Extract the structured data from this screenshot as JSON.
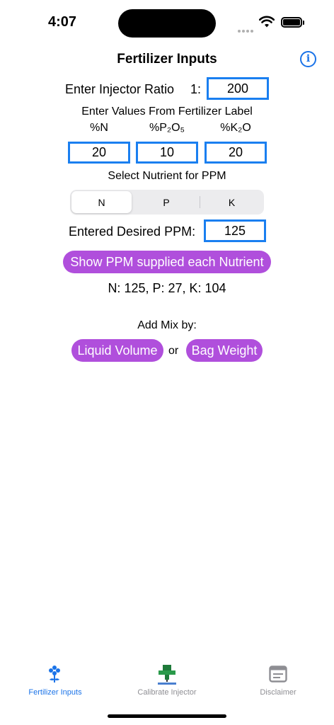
{
  "status_bar": {
    "time": "4:07"
  },
  "header": {
    "title": "Fertilizer Inputs",
    "info_glyph": "i"
  },
  "injector": {
    "label": "Enter Injector Ratio",
    "prefix": "1:",
    "value": "200"
  },
  "label_values": {
    "heading": "Enter Values From Fertilizer Label",
    "columns": [
      "%N",
      "%P₂O₅",
      "%K₂O"
    ],
    "values": [
      "20",
      "10",
      "20"
    ]
  },
  "nutrient_select": {
    "heading": "Select Nutrient for PPM",
    "options": [
      "N",
      "P",
      "K"
    ],
    "selected": "N"
  },
  "desired_ppm": {
    "label": "Entered Desired PPM:",
    "value": "125"
  },
  "show_ppm_button": "Show PPM supplied each Nutrient",
  "ppm_result": "N: 125, P: 27, K: 104",
  "add_mix": {
    "heading": "Add Mix by:",
    "liquid_button": "Liquid Volume",
    "or_text": "or",
    "bag_button": "Bag Weight"
  },
  "tab_bar": {
    "items": [
      {
        "label": "Fertilizer Inputs",
        "icon": "flower-icon",
        "active": true
      },
      {
        "label": "Calibrate Injector",
        "icon": "injector-icon",
        "active": false
      },
      {
        "label": "Disclaimer",
        "icon": "document-icon",
        "active": false
      }
    ]
  },
  "colors": {
    "accent": "#1a73e8",
    "field_border": "#1a7ff0",
    "button": "#b04fdc",
    "inactive_tab": "#8e8e93"
  }
}
